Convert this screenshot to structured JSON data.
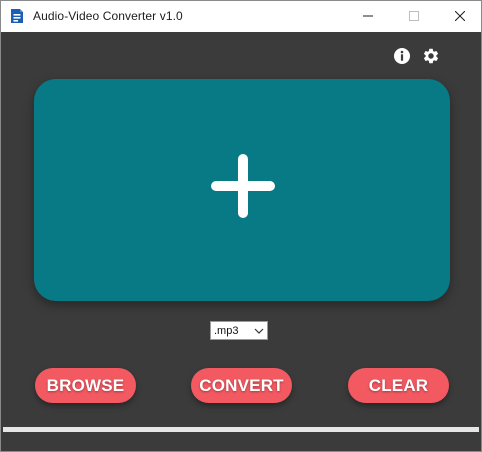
{
  "window": {
    "title": "Audio-Video Converter v1.0",
    "app_icon": "converter-app-icon",
    "controls": [
      "minimize-icon",
      "maximize-icon",
      "close-icon"
    ]
  },
  "toolbar": {
    "info_icon": "info-icon",
    "settings_icon": "gear-icon"
  },
  "drop_zone": {
    "icon": "plus-icon",
    "color": "#087a85"
  },
  "format": {
    "selected": ".mp3"
  },
  "buttons": {
    "browse": "BROWSE",
    "convert": "CONVERT",
    "clear": "CLEAR",
    "color": "#f25961"
  },
  "colors": {
    "background": "#3b3b3b",
    "progress_track": "#e6e6e6"
  }
}
